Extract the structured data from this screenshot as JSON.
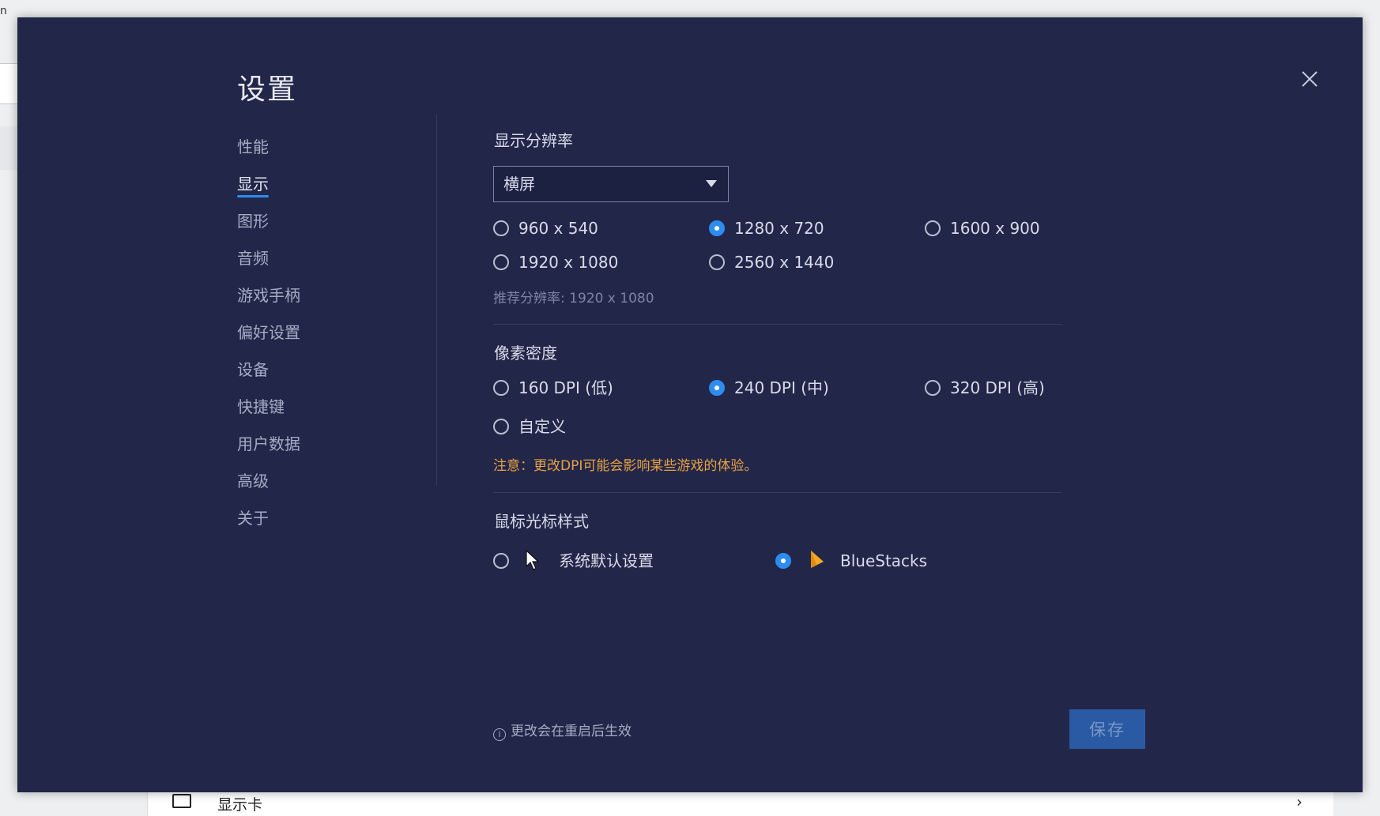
{
  "background": {
    "corner_text": "n",
    "bottom_label": "显示卡",
    "bottom_chevron": "›"
  },
  "modal": {
    "title": "设置",
    "close_icon": "close-icon"
  },
  "sidebar": {
    "items": [
      {
        "label": "性能",
        "active": false
      },
      {
        "label": "显示",
        "active": true
      },
      {
        "label": "图形",
        "active": false
      },
      {
        "label": "音频",
        "active": false
      },
      {
        "label": "游戏手柄",
        "active": false
      },
      {
        "label": "偏好设置",
        "active": false
      },
      {
        "label": "设备",
        "active": false
      },
      {
        "label": "快捷键",
        "active": false
      },
      {
        "label": "用户数据",
        "active": false
      },
      {
        "label": "高级",
        "active": false
      },
      {
        "label": "关于",
        "active": false
      }
    ]
  },
  "resolution": {
    "title": "显示分辨率",
    "orientation_value": "横屏",
    "options": [
      {
        "label": "960 x 540",
        "checked": false
      },
      {
        "label": "1280 x 720",
        "checked": true
      },
      {
        "label": "1600 x 900",
        "checked": false
      },
      {
        "label": "1920 x 1080",
        "checked": false
      },
      {
        "label": "2560 x 1440",
        "checked": false
      }
    ],
    "recommended": "推荐分辨率: 1920 x 1080"
  },
  "dpi": {
    "title": "像素密度",
    "options": [
      {
        "label": "160 DPI (低)",
        "checked": false
      },
      {
        "label": "240 DPI (中)",
        "checked": true
      },
      {
        "label": "320 DPI (高)",
        "checked": false
      },
      {
        "label": "自定义",
        "checked": false
      }
    ],
    "warning": "注意：更改DPI可能会影响某些游戏的体验。"
  },
  "cursor": {
    "title": "鼠标光标样式",
    "options": [
      {
        "label": "系统默认设置",
        "checked": false,
        "icon": "arrow-cursor-icon"
      },
      {
        "label": "BlueStacks",
        "checked": true,
        "icon": "bluestacks-cursor-icon"
      }
    ]
  },
  "footer": {
    "note": "更改会在重启后生效",
    "info_icon": "info-icon",
    "save_label": "保存"
  },
  "colors": {
    "modal_bg": "#222749",
    "accent": "#2e8cf0",
    "warning": "#e8a042",
    "save_button": "#2a5aa3"
  }
}
